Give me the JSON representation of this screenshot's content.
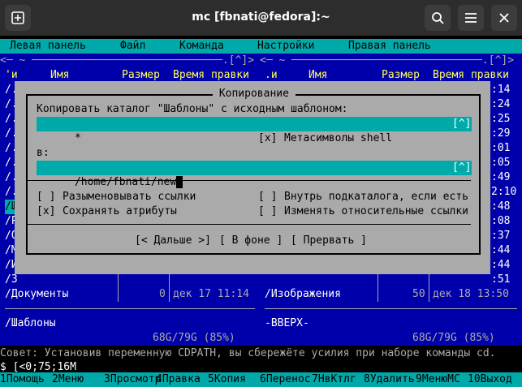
{
  "window": {
    "title": "mc [fbnati@fedora]:~"
  },
  "menubar": {
    "left": "Левая панель",
    "file": "Файл",
    "command": "Команда",
    "settings": "Настройки",
    "right": "Правая панель"
  },
  "left_panel": {
    "top": "<─ ~ ──────────────────────────────.[^]>",
    "col_name": "Имя",
    "col_size": "Размер",
    "col_time": "Время правки",
    "col_sort": "'и",
    "rows": [
      "/.",
      "/.",
      "/.",
      "/.",
      "/.",
      "/.",
      "/.",
      "/.",
      "/Ш",
      "/Р",
      "/О",
      "/М",
      "/И",
      "/З"
    ],
    "last_row_name": "/Документы",
    "last_row_size": "0",
    "last_row_date": "дек 17 11:14",
    "mini_status": "/Шаблоны",
    "disk": "68G/79G (85%)"
  },
  "right_panel": {
    "top": "<─ ~ ──────────────────────────────.[^]>",
    "col_name": "Имя",
    "col_size": "Размер",
    "col_time": "Время правки",
    "col_sort": ".и",
    "edge": [
      ":14",
      ":24",
      ":25",
      ":29",
      ":01",
      ":05",
      ":49",
      "2:10",
      ":48",
      ":08",
      ":37",
      ":44",
      ":44",
      ":51"
    ],
    "last_row_name": "/Изображения",
    "last_row_size": "50",
    "last_row_date": "дек 18 13:50",
    "mini_status": "-ВВЕРХ-",
    "disk": "68G/79G (85%)"
  },
  "dialog": {
    "title": " Копирование ",
    "source_label": "Копировать каталог \"Шаблоны\" с исходным шаблоном:",
    "source_value": "*",
    "dropdown": "[^]",
    "shell_check": "[x]",
    "shell_label": "Метасимволы shell",
    "dest_label": "в:",
    "dest_value": "/home/fbnati/new",
    "deref_check": "[ ]",
    "deref_label": "Разыменовывать ссылки",
    "into_check": "[ ]",
    "into_label": "Внутрь подкаталога, если есть",
    "attrs_check": "[x]",
    "attrs_label": "Сохранять атрибуты",
    "rel_check": "[ ]",
    "rel_label": "Изменять относительные ссылки",
    "btn_ok": "[< Дальше >]",
    "btn_bg": "[ В фоне ]",
    "btn_abort": "[ Прервать ]"
  },
  "hint": "Совет: Установив переменную CDPATH, вы сбережёте усилия при наборе команды cd.",
  "prompt": "$ [<0;75;16M",
  "fkeys": [
    "1Помощь",
    "2Меню",
    "3Просмотр",
    "4Правка",
    "5Копия",
    "6Перенос",
    "7НвКтлг",
    "8Удалить",
    "9МенюMC",
    "10Выход"
  ]
}
